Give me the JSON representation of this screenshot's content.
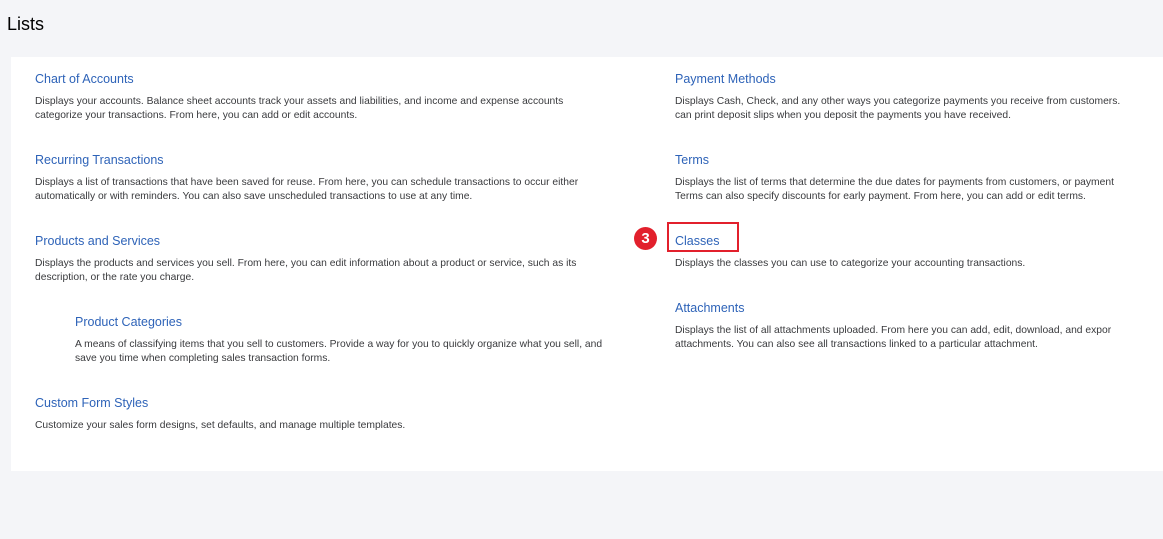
{
  "page": {
    "title": "Lists"
  },
  "left_items": [
    {
      "title": "Chart of Accounts",
      "desc_lines": [
        "Displays your accounts. Balance sheet accounts track your assets and liabilities, and income and expense accounts",
        "categorize your transactions. From here, you can add or edit accounts."
      ]
    },
    {
      "title": "Recurring Transactions",
      "desc_lines": [
        "Displays a list of transactions that have been saved for reuse. From here, you can schedule transactions to occur either",
        "automatically or with reminders. You can also save unscheduled transactions to use at any time."
      ]
    },
    {
      "title": "Products and Services",
      "desc_lines": [
        "Displays the products and services you sell. From here, you can edit information about a product or service, such as its",
        "description, or the rate you charge."
      ]
    },
    {
      "title": "Product Categories",
      "desc_lines": [
        "A means of classifying items that you sell to customers. Provide a way for you to quickly organize what you sell, and",
        "save you time when completing sales transaction forms."
      ]
    },
    {
      "title": "Custom Form Styles",
      "desc_lines": [
        "Customize your sales form designs, set defaults, and manage multiple templates."
      ]
    }
  ],
  "right_items": [
    {
      "title": "Payment Methods",
      "desc_lines": [
        "Displays Cash, Check, and any other ways you categorize payments you receive from customers.",
        "can print deposit slips when you deposit the payments you have received."
      ]
    },
    {
      "title": "Terms",
      "desc_lines": [
        "Displays the list of terms that determine the due dates for payments from customers, or payment",
        "Terms can also specify discounts for early payment. From here, you can add or edit terms."
      ]
    },
    {
      "title": "Classes",
      "desc_lines": [
        "Displays the classes you can use to categorize your accounting transactions."
      ]
    },
    {
      "title": "Attachments",
      "desc_lines": [
        "Displays the list of all attachments uploaded. From here you can add, edit, download, and expor",
        "attachments. You can also see all transactions linked to a particular attachment."
      ]
    }
  ],
  "annotation": {
    "step_number": "3",
    "color": "#e2202c"
  },
  "colors": {
    "link": "#2e63b8",
    "background": "#f4f5f8",
    "card": "#ffffff"
  }
}
